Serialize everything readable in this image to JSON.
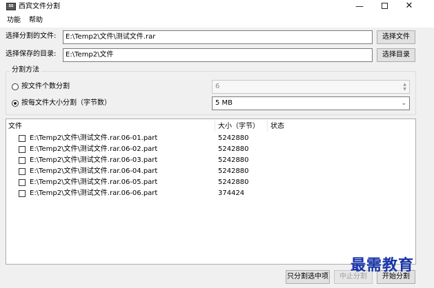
{
  "window": {
    "title": "西宾文件分割",
    "icon_name": "app-icon",
    "minimize_glyph": "—",
    "close_glyph": "✕"
  },
  "menu": {
    "items": [
      "功能",
      "帮助"
    ]
  },
  "source": {
    "label": "选择分割的文件:",
    "value": "E:\\Temp2\\文件\\测试文件.rar",
    "button": "选择文件"
  },
  "output": {
    "label": "选择保存的目录:",
    "value": "E:\\Temp2\\文件",
    "button": "选择目录"
  },
  "split_method": {
    "title": "分割方法",
    "by_count": {
      "label": "按文件个数分割",
      "selected": false,
      "value": "6"
    },
    "by_size": {
      "label": "按每文件大小分割（字节数）",
      "selected": true,
      "value": "5 MB"
    }
  },
  "file_list": {
    "columns": [
      "文件",
      "大小（字节）",
      "状态"
    ],
    "rows": [
      {
        "name": "E:\\Temp2\\文件\\测试文件.rar.06-01.part",
        "size": "5242880",
        "status": ""
      },
      {
        "name": "E:\\Temp2\\文件\\测试文件.rar.06-02.part",
        "size": "5242880",
        "status": ""
      },
      {
        "name": "E:\\Temp2\\文件\\测试文件.rar.06-03.part",
        "size": "5242880",
        "status": ""
      },
      {
        "name": "E:\\Temp2\\文件\\测试文件.rar.06-04.part",
        "size": "5242880",
        "status": ""
      },
      {
        "name": "E:\\Temp2\\文件\\测试文件.rar.06-05.part",
        "size": "5242880",
        "status": ""
      },
      {
        "name": "E:\\Temp2\\文件\\测试文件.rar.06-06.part",
        "size": "374424",
        "status": ""
      }
    ]
  },
  "actions": {
    "split_selected": "只分割选中项",
    "stop": "中止分割",
    "start": "开始分割"
  },
  "watermark": "最需教育"
}
